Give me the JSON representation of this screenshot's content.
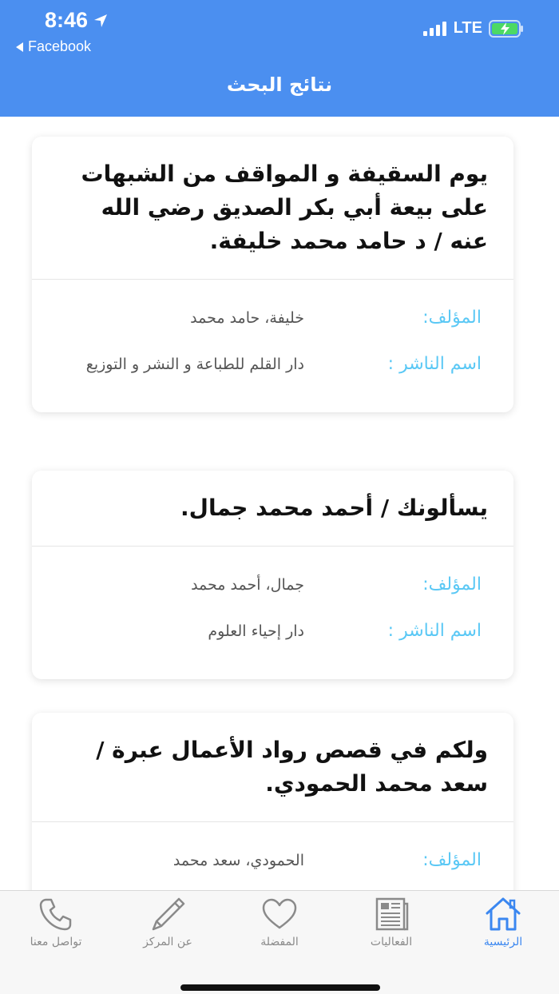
{
  "status_bar": {
    "time": "8:46",
    "back_app": "Facebook",
    "network": "LTE"
  },
  "header": {
    "title": "نتائج البحث"
  },
  "results": [
    {
      "title": "يوم السقيفة و المواقف من الشبهات على بيعة أبي بكر الصديق رضي الله عنه / د حامد محمد خليفة.",
      "author_label": "المؤلف:",
      "author": "خليفة، حامد محمد",
      "publisher_label": "اسم الناشر :",
      "publisher": "دار القلم للطباعة و النشر و التوزيع"
    },
    {
      "title": "يسألونك / أحمد محمد جمال.",
      "author_label": "المؤلف:",
      "author": "جمال، أحمد محمد",
      "publisher_label": "اسم الناشر :",
      "publisher": "دار إحياء العلوم"
    },
    {
      "title": "ولكم في قصص رواد الأعمال عبرة / سعد محمد الحمودي.",
      "author_label": "المؤلف:",
      "author": "الحمودي، سعد محمد"
    }
  ],
  "tabs": [
    {
      "label": "الرئيسية",
      "icon": "home-icon",
      "active": true
    },
    {
      "label": "الفعاليات",
      "icon": "newspaper-icon",
      "active": false
    },
    {
      "label": "المفضلة",
      "icon": "heart-icon",
      "active": false
    },
    {
      "label": "عن المركز",
      "icon": "pencil-icon",
      "active": false
    },
    {
      "label": "تواصل معنا",
      "icon": "phone-icon",
      "active": false
    }
  ],
  "colors": {
    "header": "#4b8ff0",
    "label": "#5ac8f5",
    "tab_active": "#3b87f0",
    "tab_inactive": "#8a8a8a"
  }
}
